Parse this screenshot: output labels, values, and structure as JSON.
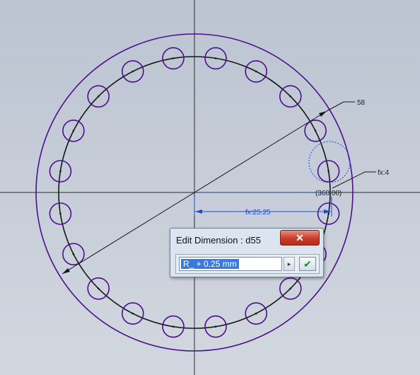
{
  "canvas": {
    "background": "#c8ced8",
    "sketch_color": "#4b0f8f",
    "dimension_color": "#1a49d8"
  },
  "dimensions": {
    "diameter_label": "58",
    "hole_label": "fx:4",
    "angle_label": "(360.00)",
    "radius_label": "fx:25.25"
  },
  "dialog": {
    "title": "Edit Dimension : d55",
    "close_symbol": "✕",
    "value": "R_ + 0.25 mm",
    "arrow_symbol": "▸",
    "accept_symbol": "✔",
    "accept_color": "#1e8a1e",
    "close_color": "#c63c2a"
  }
}
